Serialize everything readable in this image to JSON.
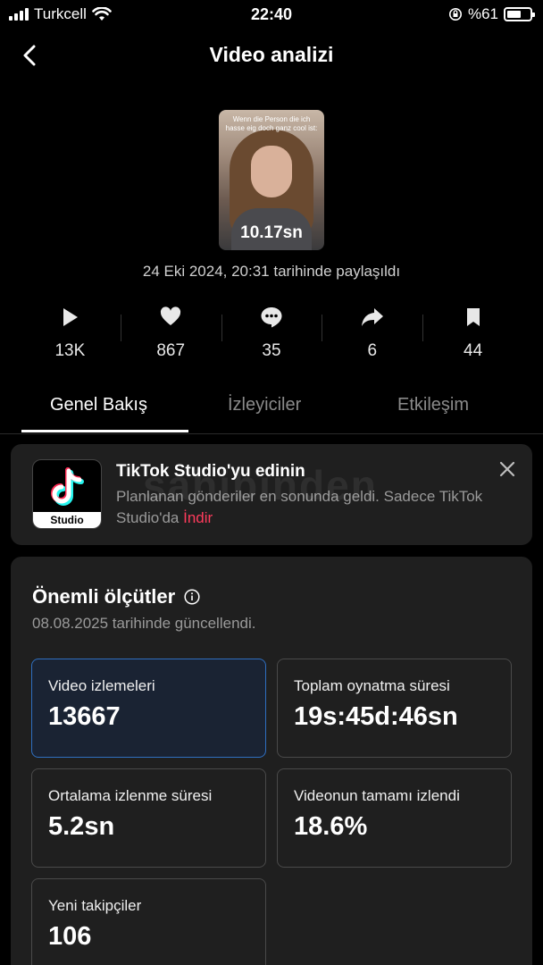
{
  "status_bar": {
    "carrier": "Turkcell",
    "time": "22:40",
    "battery_text": "%61",
    "battery_level": 0.61
  },
  "header": {
    "title": "Video analizi",
    "back_icon": "chevron-left-icon"
  },
  "video": {
    "caption": "Wenn die Person die ich hasse eig doch ganz cool ist:",
    "duration": "10.17sn",
    "posted_text": "24 Eki 2024, 20:31 tarihinde paylaşıldı"
  },
  "stats": [
    {
      "icon": "play-icon",
      "value": "13K"
    },
    {
      "icon": "heart-icon",
      "value": "867"
    },
    {
      "icon": "comment-icon",
      "value": "35"
    },
    {
      "icon": "share-icon",
      "value": "6"
    },
    {
      "icon": "bookmark-icon",
      "value": "44"
    }
  ],
  "tabs": [
    {
      "label": "Genel Bakış",
      "active": true
    },
    {
      "label": "İzleyiciler",
      "active": false
    },
    {
      "label": "Etkileşim",
      "active": false
    }
  ],
  "promo": {
    "logo_text": "Studio",
    "title": "TikTok Studio'yu edinin",
    "text": "Planlanan gönderiler en sonunda geldi. Sadece TikTok Studio'da ",
    "link": "İndir",
    "watermark": "sahibinden"
  },
  "metrics": {
    "title": "Önemli ölçütler",
    "updated": "08.08.2025 tarihinde güncellendi.",
    "cards": [
      {
        "label": "Video izlemeleri",
        "value": "13667",
        "selected": true
      },
      {
        "label": "Toplam oynatma süresi",
        "value": "19s:45d:46sn",
        "selected": false
      },
      {
        "label": "Ortalama izlenme süresi",
        "value": "5.2sn",
        "selected": false
      },
      {
        "label": "Videonun tamamı izlendi",
        "value": "18.6%",
        "selected": false
      },
      {
        "label": "Yeni takipçiler",
        "value": "106",
        "selected": false
      }
    ]
  },
  "colors": {
    "background": "#000000",
    "card_bg": "#1f1f1f",
    "accent_link": "#ff3b5c",
    "selected_border": "#2f6fc0",
    "tiktok_cyan": "#25f4ee",
    "tiktok_red": "#fe2c55"
  }
}
